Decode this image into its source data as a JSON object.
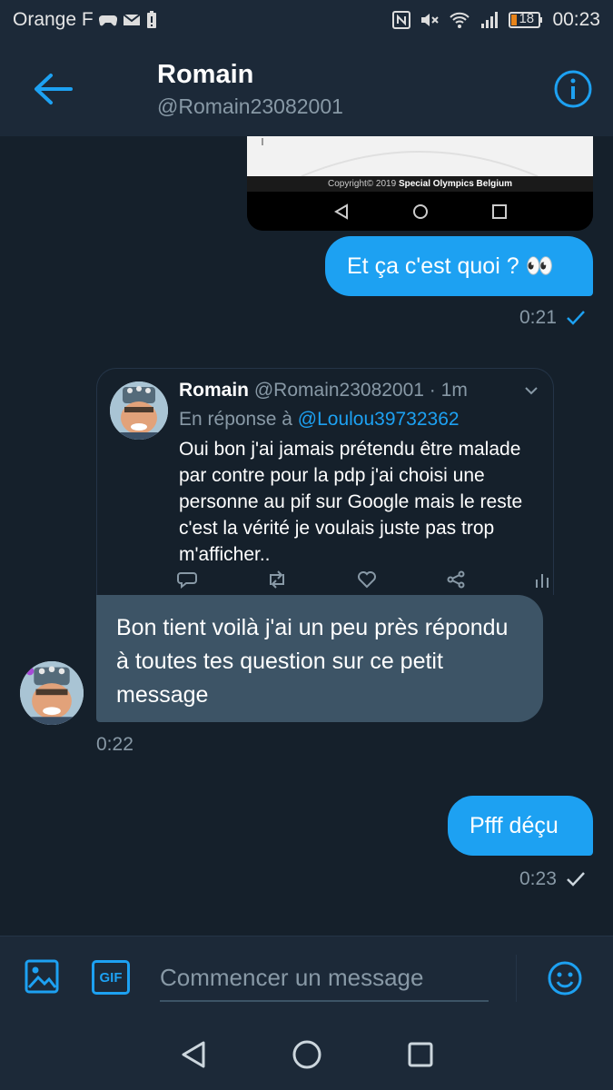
{
  "status_bar": {
    "carrier": "Orange F",
    "battery": "18",
    "time": "00:23"
  },
  "header": {
    "name": "Romain",
    "handle": "@Romain23082001"
  },
  "messages": {
    "image_caption_prefix": "Copyright© 2019 ",
    "image_caption_bold": "Special Olympics Belgium",
    "out1_text": "Et ça c'est quoi ? 👀",
    "out1_time": "0:21",
    "tweet": {
      "name": "Romain",
      "meta": "@Romain23082001 · 1m",
      "reply_prefix": "En réponse à ",
      "reply_to": "@Loulou39732362",
      "text": "Oui bon j'ai jamais prétendu être malade par contre pour la pdp j'ai choisi une personne au pif sur Google mais le reste c'est la vérité je voulais juste pas trop m'afficher.."
    },
    "in1_text": "Bon tient voilà j'ai un peu près répondu à toutes tes question sur ce petit message",
    "in1_time": "0:22",
    "out2_text": "Pfff déçu",
    "out2_time": "0:23"
  },
  "composer": {
    "gif_label": "GIF",
    "placeholder": "Commencer un message"
  },
  "colors": {
    "accent": "#1da1f2",
    "background": "#15202b",
    "header": "#1c2938",
    "incoming_bubble": "#3d5466"
  }
}
